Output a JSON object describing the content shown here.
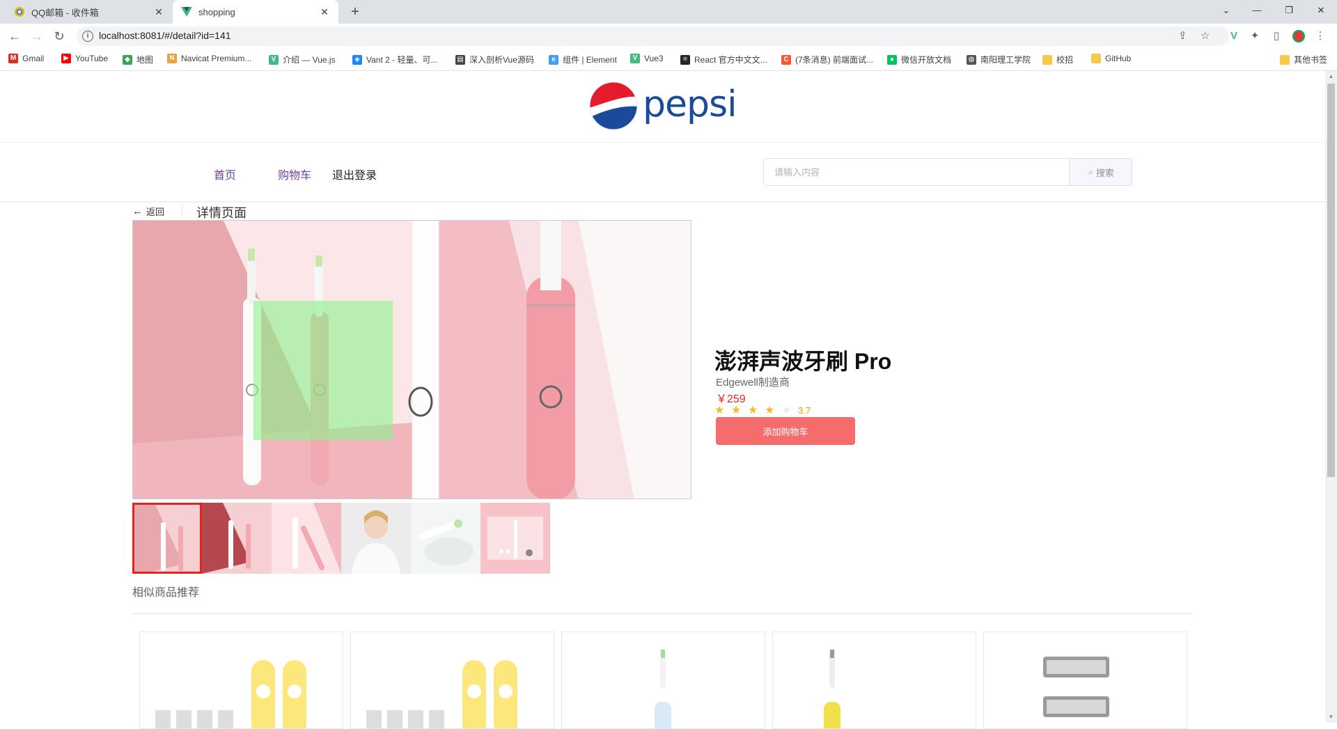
{
  "browser": {
    "tabs": [
      {
        "title": "QQ邮箱 - 收件箱",
        "active": false
      },
      {
        "title": "shopping",
        "active": true
      }
    ],
    "url": "localhost:8081/#/detail?id=141",
    "bookmarks": [
      {
        "label": "Gmail",
        "icon": "gmail-icon",
        "color": "#d93025"
      },
      {
        "label": "YouTube",
        "icon": "youtube-icon",
        "color": "#ff0000"
      },
      {
        "label": "地图",
        "icon": "maps-icon",
        "color": "#34a853"
      },
      {
        "label": "Navicat Premium...",
        "icon": "navicat-icon",
        "color": "#e8a33d"
      },
      {
        "label": "介绍 — Vue.js",
        "icon": "vue-icon",
        "color": "#42b883"
      },
      {
        "label": "Vant 2 - 轻量、可...",
        "icon": "vant-icon",
        "color": "#1989fa"
      },
      {
        "label": "深入剖析Vue源码",
        "icon": "book-icon",
        "color": "#444444"
      },
      {
        "label": "组件 | Element",
        "icon": "element-icon",
        "color": "#409eff"
      },
      {
        "label": "Vue3",
        "icon": "vue-icon",
        "color": "#42b883"
      },
      {
        "label": "React 官方中文文...",
        "icon": "react-icon",
        "color": "#20232a"
      },
      {
        "label": "(7条消息) 前端面试...",
        "icon": "csdn-icon",
        "color": "#fc5531"
      },
      {
        "label": "微信开放文档",
        "icon": "wechat-icon",
        "color": "#07c160"
      },
      {
        "label": "南阳理工学院",
        "icon": "globe-icon",
        "color": "#555555"
      },
      {
        "label": "校招",
        "icon": "folder-icon",
        "color": "#f7c948"
      },
      {
        "label": "GitHub",
        "icon": "folder-icon",
        "color": "#f7c948"
      }
    ],
    "other_bookmarks": "其他书签"
  },
  "header": {
    "logo_text": "pepsi",
    "nav": [
      {
        "label": "首页",
        "color": "#6b3fa0"
      },
      {
        "label": "购物车",
        "color": "#6b3fa0"
      },
      {
        "label": "退出登录",
        "color": "#222222"
      }
    ],
    "search_placeholder": "请输入内容",
    "search_button": "搜索"
  },
  "detail": {
    "back_label": "返回",
    "page_title": "详情页面",
    "product_name": "澎湃声波牙刷 Pro",
    "brand": "Edgewell制造商",
    "price": "￥259",
    "rating": 3.7,
    "rating_text": "3.7",
    "add_to_cart": "添加购物车",
    "thumbnails": [
      "toothbrush-pair-pink",
      "toothbrush-pair-pink-2",
      "toothbrush-tilted",
      "woman-smiling",
      "brush-head-water",
      "toothbrush-set-box"
    ],
    "selected_thumbnail": 0
  },
  "similar": {
    "title": "相似商品推荐",
    "items": [
      "brush-heads-yellow",
      "brush-heads-yellow-2",
      "toothbrush-blue",
      "toothbrush-yellow",
      "razor-cartridges"
    ]
  },
  "colors": {
    "accent_red": "#f56c6c",
    "price_red": "#e4231d",
    "star_orange": "#f7ba2a",
    "nav_purple": "#6b3fa0"
  }
}
